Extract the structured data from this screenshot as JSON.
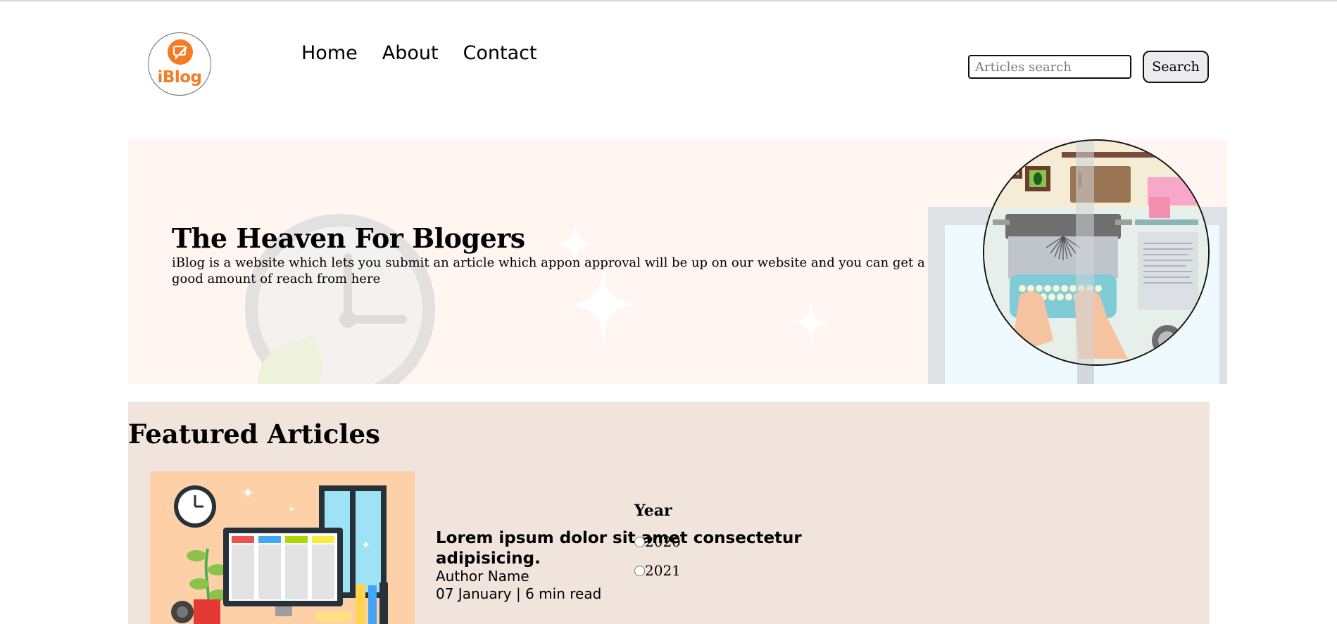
{
  "logo": {
    "text": "iBlog",
    "color": "#f57c22"
  },
  "nav": {
    "items": [
      "Home",
      "About",
      "Contact"
    ]
  },
  "search": {
    "placeholder": "Articles search",
    "button_label": "Search"
  },
  "hero": {
    "title": "The Heaven For Blogers",
    "text": "iBlog is a website which lets you submit an article which appon approval will be up on our website and you can get a good amount of reach from here",
    "background_color": "#fff6f1"
  },
  "featured": {
    "heading": "Featured Articles",
    "background_color": "#f0e4dd",
    "article": {
      "title": "Lorem ipsum dolor sit amet consectetur adipisicing.",
      "author": "Author Name",
      "meta": "07 January | 6 min read"
    },
    "filter": {
      "heading": "Year",
      "options": [
        "2020",
        "2021"
      ]
    }
  },
  "icons": [
    "chat-edit-icon",
    "clock-illustration",
    "typewriter-illustration",
    "workspace-illustration"
  ]
}
